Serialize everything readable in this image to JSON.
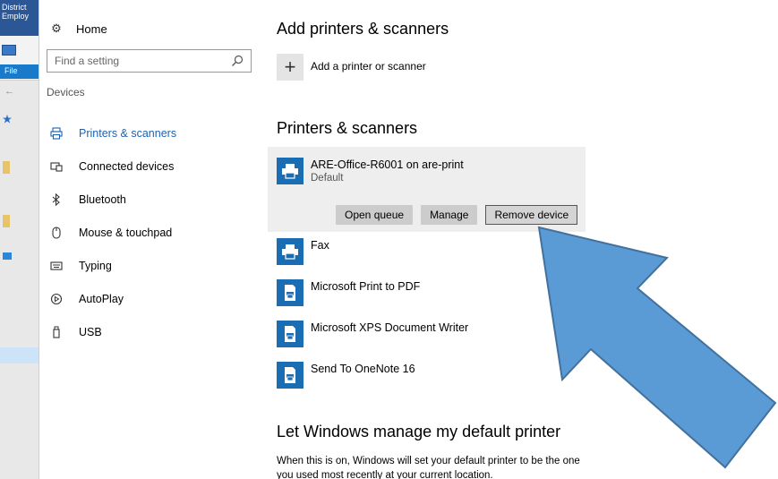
{
  "background_window": {
    "title": "District Employ",
    "file_tab": "File"
  },
  "nav": {
    "home_label": "Home",
    "search_placeholder": "Find a setting",
    "section_label": "Devices",
    "items": [
      {
        "label": "Printers & scanners",
        "icon": "printer-icon",
        "active": true
      },
      {
        "label": "Connected devices",
        "icon": "connected-devices-icon",
        "active": false
      },
      {
        "label": "Bluetooth",
        "icon": "bluetooth-icon",
        "active": false
      },
      {
        "label": "Mouse & touchpad",
        "icon": "mouse-icon",
        "active": false
      },
      {
        "label": "Typing",
        "icon": "keyboard-icon",
        "active": false
      },
      {
        "label": "AutoPlay",
        "icon": "autoplay-icon",
        "active": false
      },
      {
        "label": "USB",
        "icon": "usb-icon",
        "active": false
      }
    ]
  },
  "main": {
    "add_heading": "Add printers & scanners",
    "add_label": "Add a printer or scanner",
    "printers_heading": "Printers & scanners",
    "printers": [
      {
        "name": "ARE-Office-R6001 on are-print",
        "status": "Default",
        "icon": "printer-icon",
        "selected": true
      },
      {
        "name": "Fax",
        "status": "",
        "icon": "printer-icon",
        "selected": false
      },
      {
        "name": "Microsoft Print to PDF",
        "status": "",
        "icon": "document-printer-icon",
        "selected": false
      },
      {
        "name": "Microsoft XPS Document Writer",
        "status": "",
        "icon": "document-printer-icon",
        "selected": false
      },
      {
        "name": "Send To OneNote 16",
        "status": "",
        "icon": "document-printer-icon",
        "selected": false
      }
    ],
    "buttons": {
      "open_queue": "Open queue",
      "manage": "Manage",
      "remove_device": "Remove device"
    },
    "default_heading": "Let Windows manage my default printer",
    "default_desc": "When this is on, Windows will set your default printer to be the one you used most recently at your current location."
  },
  "colors": {
    "accent": "#1b62b3",
    "printer_tile": "#1a6cb3",
    "arrow_fill": "#5b9bd5",
    "arrow_stroke": "#41719c",
    "selection_bg": "#eeeeee"
  }
}
